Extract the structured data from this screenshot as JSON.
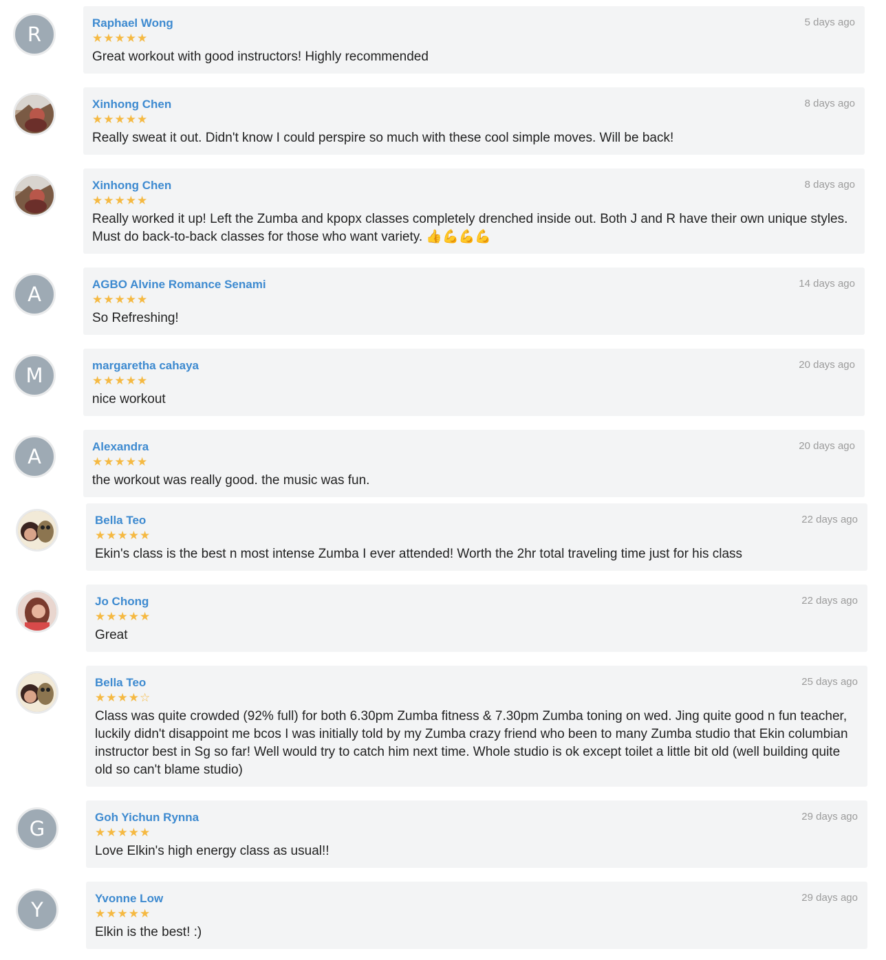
{
  "reviews": [
    {
      "initial": "R",
      "name": "Raphael Wong",
      "rating": 5,
      "time": "5 days ago",
      "text": "Great workout with good instructors! Highly recommended"
    },
    {
      "initial": "",
      "name": "Xinhong Chen",
      "rating": 5,
      "time": "8 days ago",
      "text": "Really sweat it out. Didn't know I could perspire so much with these cool simple moves. Will be back!"
    },
    {
      "initial": "",
      "name": "Xinhong Chen",
      "rating": 5,
      "time": "8 days ago",
      "text": "Really worked it up! Left the Zumba and kpopx classes completely drenched inside out. Both J and R have their own unique styles. Must do back-to-back classes for those who want variety. 👍💪💪💪"
    },
    {
      "initial": "A",
      "name": "AGBO Alvine Romance Senami",
      "rating": 5,
      "time": "14 days ago",
      "text": "So Refreshing!"
    },
    {
      "initial": "M",
      "name": "margaretha cahaya",
      "rating": 5,
      "time": "20 days ago",
      "text": "nice workout"
    },
    {
      "initial": "A",
      "name": "Alexandra",
      "rating": 5,
      "time": "20 days ago",
      "text": "the workout was really good. the music was fun."
    },
    {
      "initial": "",
      "name": "Bella Teo",
      "rating": 5,
      "time": "22 days ago",
      "text": "Ekin's class is the best n most intense Zumba I ever attended! Worth the 2hr total traveling time just for his class"
    },
    {
      "initial": "",
      "name": "Jo Chong",
      "rating": 5,
      "time": "22 days ago",
      "text": "Great"
    },
    {
      "initial": "",
      "name": "Bella Teo",
      "rating": 4,
      "time": "25 days ago",
      "text": "Class was quite crowded (92% full) for both 6.30pm Zumba fitness & 7.30pm Zumba toning on wed. Jing quite good n fun teacher, luckily didn't disappoint me bcos I was initially told by my Zumba crazy friend who been to many Zumba studio that Ekin columbian instructor best in Sg so far! Well would try to catch him next time. Whole studio is ok except toilet a little bit old (well building quite old so can't blame studio)"
    },
    {
      "initial": "G",
      "name": "Goh Yichun Rynna",
      "rating": 5,
      "time": "29 days ago",
      "text": "Love Elkin's high energy class as usual!!"
    },
    {
      "initial": "Y",
      "name": "Yvonne Low",
      "rating": 5,
      "time": "29 days ago",
      "text": "Elkin is the best! :)"
    }
  ],
  "colors": {
    "name": "#3d8ad0",
    "star": "#f5b942",
    "card": "#f3f4f5",
    "avatar": "#9eaab4",
    "time": "#9b9b9b"
  }
}
